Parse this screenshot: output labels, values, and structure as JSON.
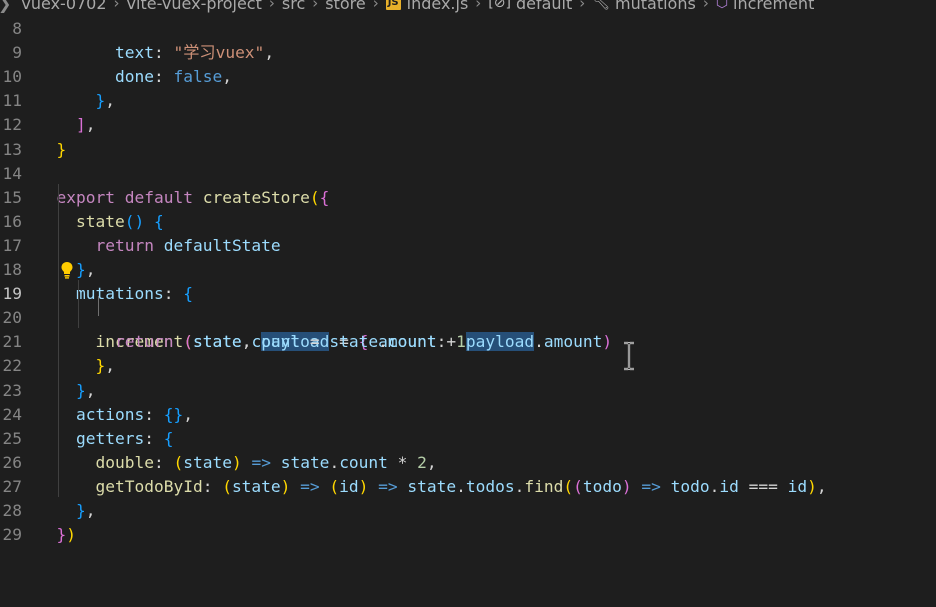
{
  "breadcrumb": {
    "items": [
      "vuex-0702",
      "vite-vuex-project",
      "src",
      "store",
      "index.js",
      "default",
      "mutations",
      "increment"
    ],
    "js_badge": "JS"
  },
  "editor": {
    "active_line": 19,
    "lines": [
      {
        "n": "8",
        "text": "        text: \"学习vuex\","
      },
      {
        "n": "9",
        "text": "        done: false,"
      },
      {
        "n": "10",
        "text": "      },"
      },
      {
        "n": "11",
        "text": "    ],"
      },
      {
        "n": "12",
        "text": "  }"
      },
      {
        "n": "13",
        "text": ""
      },
      {
        "n": "14",
        "text": "export default createStore({"
      },
      {
        "n": "15",
        "text": "  state() {"
      },
      {
        "n": "16",
        "text": "    return defaultState"
      },
      {
        "n": "17",
        "text": "  },"
      },
      {
        "n": "18",
        "text": "  mutations: {"
      },
      {
        "n": "19",
        "text": "    increment(state, payload = { amount: 1 }) {"
      },
      {
        "n": "20",
        "text": "      return (state.count = state.count + payload.amount)"
      },
      {
        "n": "21",
        "text": "    },"
      },
      {
        "n": "22",
        "text": "  },"
      },
      {
        "n": "23",
        "text": "  actions: {},"
      },
      {
        "n": "24",
        "text": "  getters: {"
      },
      {
        "n": "25",
        "text": "    double: (state) => state.count * 2,"
      },
      {
        "n": "26",
        "text": "    getTodoById: (state) => (id) => state.todos.find((todo) => todo.id === id),"
      },
      {
        "n": "27",
        "text": "  },"
      },
      {
        "n": "28",
        "text": "})"
      },
      {
        "n": "29",
        "text": ""
      }
    ]
  },
  "colors": {
    "background": "#1e1e1e",
    "selection_highlight": "#264f78",
    "keyword": "#c586c0",
    "function": "#dcdcaa",
    "variable": "#9cdcfe",
    "number": "#b5cea8"
  },
  "icons": [
    "js-file-icon",
    "braces-icon",
    "wrench-icon",
    "cube-icon",
    "lightbulb-icon",
    "text-cursor-icon"
  ]
}
